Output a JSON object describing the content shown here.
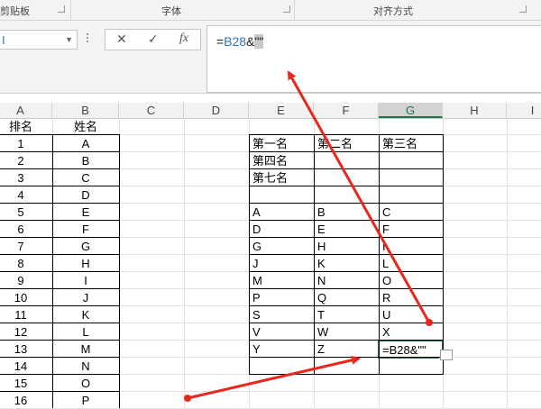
{
  "ribbon": {
    "groups": [
      "剪贴板",
      "字体",
      "对齐方式"
    ]
  },
  "name_box": {
    "value": "I"
  },
  "formula_buttons": {
    "cancel": "✕",
    "enter": "✓",
    "fx": "fx"
  },
  "formula_bar": {
    "prefix": "=",
    "ref": "B28",
    "amp": "&",
    "quotes": "\"\""
  },
  "columns": [
    "A",
    "B",
    "C",
    "D",
    "E",
    "F",
    "G",
    "H",
    "I"
  ],
  "col_A": [
    "排名",
    "1",
    "2",
    "3",
    "4",
    "5",
    "6",
    "7",
    "8",
    "9",
    "10",
    "11",
    "12",
    "13",
    "14",
    "15",
    "16"
  ],
  "col_B": [
    "姓名",
    "A",
    "B",
    "C",
    "D",
    "E",
    "F",
    "G",
    "H",
    "I",
    "J",
    "K",
    "L",
    "M",
    "N",
    "O",
    "P"
  ],
  "header_row": [
    "第一名",
    "第二名",
    "第三名"
  ],
  "label_row2": "第四名",
  "label_row3": "第七名",
  "table_rows": [
    [
      "A",
      "B",
      "C"
    ],
    [
      "D",
      "E",
      "F"
    ],
    [
      "G",
      "H",
      "I"
    ],
    [
      "J",
      "K",
      "L"
    ],
    [
      "M",
      "N",
      "O"
    ],
    [
      "P",
      "Q",
      "R"
    ],
    [
      "S",
      "T",
      "U"
    ],
    [
      "V",
      "W",
      "X"
    ],
    [
      "Y",
      "Z",
      "=B28&\"\""
    ]
  ],
  "annotation_color": "#e8281e"
}
